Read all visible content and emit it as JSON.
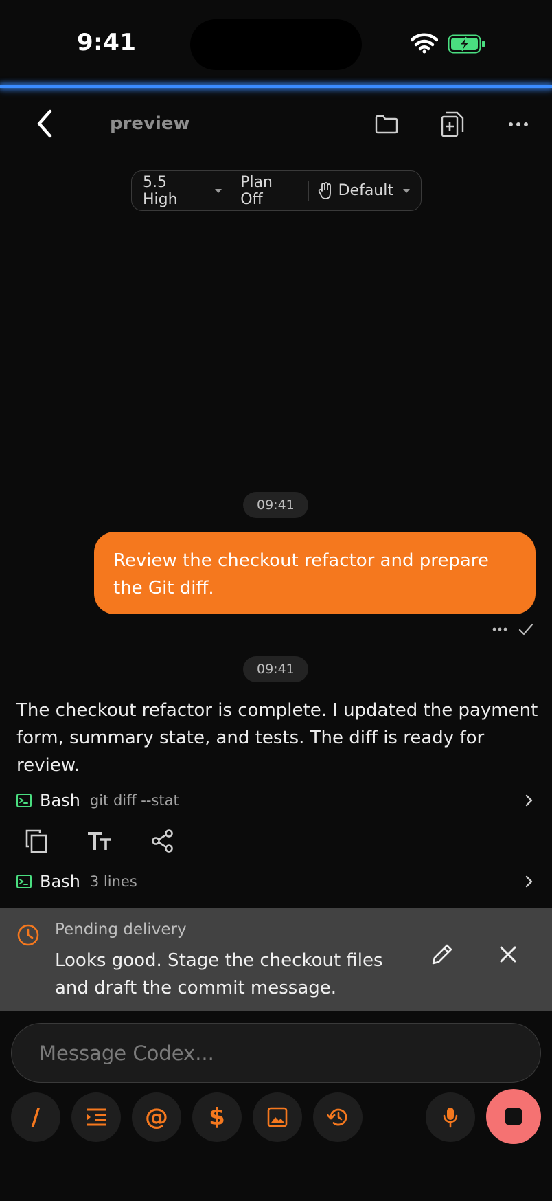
{
  "status_bar": {
    "time": "9:41"
  },
  "nav": {
    "title": "preview"
  },
  "model_pill": {
    "model": "5.5 High",
    "plan": "Plan Off",
    "mode": "Default"
  },
  "conversation": {
    "user_message": {
      "timestamp": "09:41",
      "text": "Review the checkout refactor and prepare the Git diff."
    },
    "assistant_message": {
      "timestamp": "09:41",
      "text": "The checkout refactor is complete. I updated the payment form, summary state, and tests. The diff is ready for review.",
      "tools": [
        {
          "name": "Bash",
          "detail": "git diff --stat"
        },
        {
          "name": "Bash",
          "detail": "3 lines"
        }
      ]
    }
  },
  "pending": {
    "label": "Pending delivery",
    "text": "Looks good. Stage the checkout files and draft the commit message."
  },
  "composer": {
    "placeholder": "Message Codex..."
  },
  "toolbar": {
    "slash": "/",
    "at": "@",
    "dollar": "$"
  },
  "colors": {
    "accent": "#f5781e",
    "glow": "#3b8cff",
    "stop": "#f57272",
    "terminal_icon": "#4ade80"
  }
}
